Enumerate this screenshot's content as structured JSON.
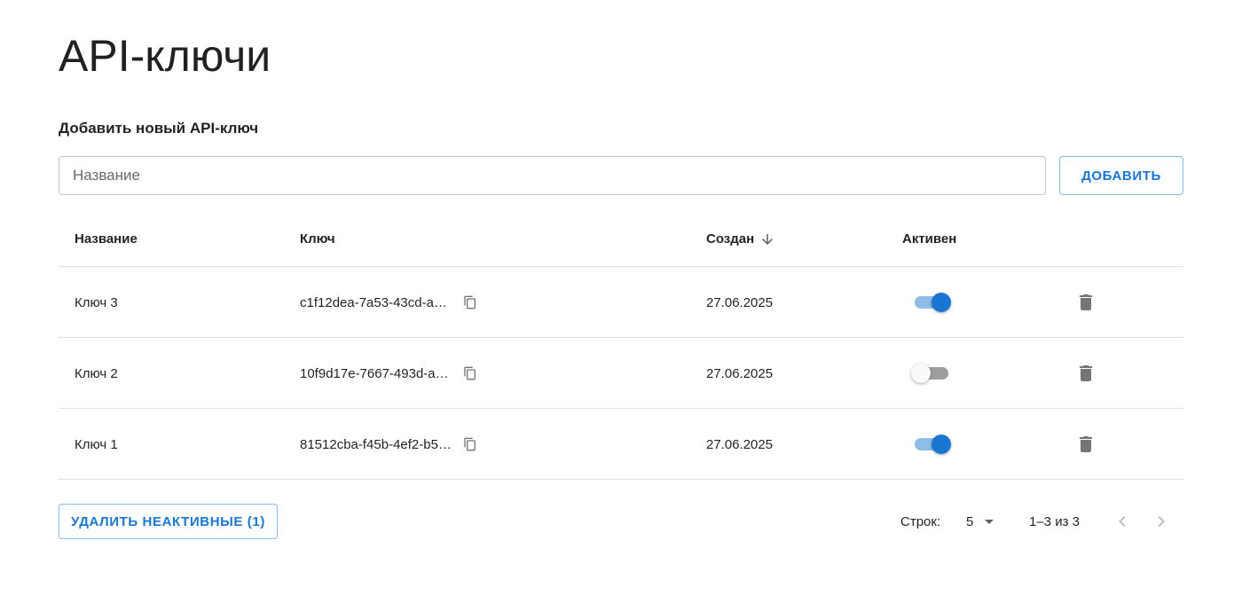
{
  "page": {
    "title": "API-ключи",
    "add_section_title": "Добавить новый API-ключ"
  },
  "form": {
    "name_placeholder": "Название",
    "name_value": "",
    "add_button_label": "ДОБАВИТЬ"
  },
  "table": {
    "columns": {
      "name": "Название",
      "key": "Ключ",
      "created": "Создан",
      "active": "Активен"
    },
    "sort": {
      "column": "created",
      "direction": "desc",
      "icon": "arrow-down-icon"
    },
    "rows": [
      {
        "name": "Ключ 3",
        "key": "c1f12dea-7a53-43cd-a…",
        "created": "27.06.2025",
        "active": true
      },
      {
        "name": "Ключ 2",
        "key": "10f9d17e-7667-493d-a…",
        "created": "27.06.2025",
        "active": false
      },
      {
        "name": "Ключ 1",
        "key": "81512cba-f45b-4ef2-b5…",
        "created": "27.06.2025",
        "active": true
      }
    ]
  },
  "footer": {
    "delete_inactive_label": "УДАЛИТЬ НЕАКТИВНЫЕ (1)",
    "rows_per_page_label": "Строк:",
    "rows_per_page_value": "5",
    "range_label": "1–3 из 3"
  },
  "icons": {
    "copy": "copy-icon",
    "delete": "trash-icon",
    "prev": "chevron-left-icon",
    "next": "chevron-right-icon",
    "dropdown": "caret-down-icon"
  },
  "colors": {
    "primary": "#1976d2",
    "switch_track_on": "#90bde8",
    "switch_track_off": "#9e9e9e",
    "divider": "#e0e0e0",
    "icon_gray": "#757575"
  }
}
